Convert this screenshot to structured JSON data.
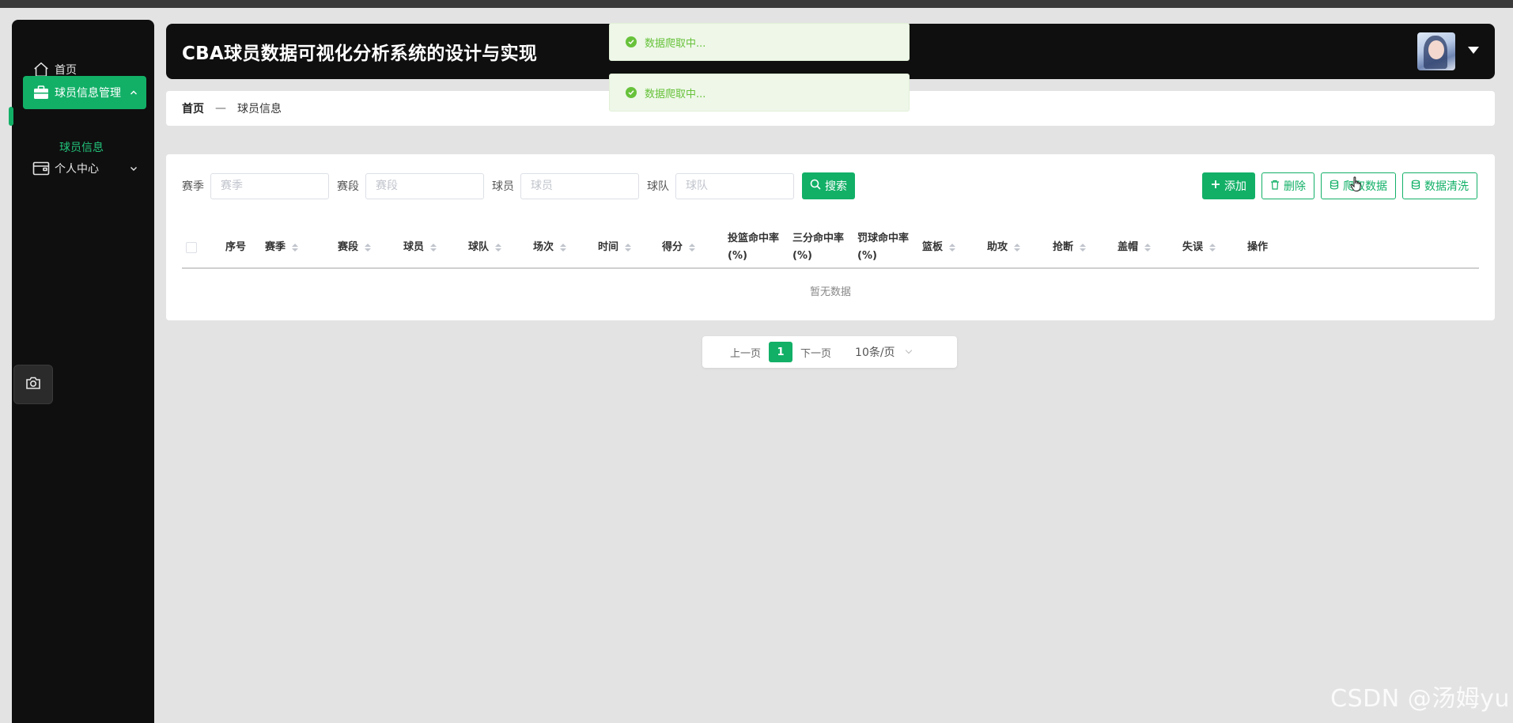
{
  "header": {
    "title": "CBA球员数据可视化分析系统的设计与实现"
  },
  "sidebar": {
    "items": [
      {
        "label": "首页",
        "icon": "home-icon"
      },
      {
        "label": "球员信息管理",
        "icon": "briefcase-icon",
        "expanded": true,
        "sub": [
          {
            "label": "球员信息"
          }
        ]
      },
      {
        "label": "个人中心",
        "icon": "wallet-icon",
        "expanded": false
      }
    ]
  },
  "breadcrumb": {
    "home": "首页",
    "sep": "—",
    "current": "球员信息"
  },
  "toasts": [
    {
      "text": "数据爬取中..."
    },
    {
      "text": "数据爬取中..."
    }
  ],
  "search": {
    "fields": [
      {
        "label": "赛季",
        "placeholder": "赛季"
      },
      {
        "label": "赛段",
        "placeholder": "赛段"
      },
      {
        "label": "球员",
        "placeholder": "球员"
      },
      {
        "label": "球队",
        "placeholder": "球队"
      }
    ],
    "button": "搜索"
  },
  "actions": {
    "add": "添加",
    "delete": "删除",
    "crawl": "爬取数据",
    "clean": "数据清洗"
  },
  "table": {
    "columns": [
      {
        "label": "序号",
        "sortable": false
      },
      {
        "label": "赛季",
        "sortable": true
      },
      {
        "label": "赛段",
        "sortable": true
      },
      {
        "label": "球员",
        "sortable": true
      },
      {
        "label": "球队",
        "sortable": true
      },
      {
        "label": "场次",
        "sortable": true
      },
      {
        "label": "时间",
        "sortable": true
      },
      {
        "label": "得分",
        "sortable": true
      },
      {
        "label": "投篮命中率",
        "label2": "(%)",
        "sortable": false
      },
      {
        "label": "三分命中率",
        "label2": "(%)",
        "sortable": false
      },
      {
        "label": "罚球命中率",
        "label2": "(%)",
        "sortable": false
      },
      {
        "label": "篮板",
        "sortable": true
      },
      {
        "label": "助攻",
        "sortable": true
      },
      {
        "label": "抢断",
        "sortable": true
      },
      {
        "label": "盖帽",
        "sortable": true
      },
      {
        "label": "失误",
        "sortable": true
      },
      {
        "label": "操作",
        "sortable": false
      }
    ],
    "empty_text": "暂无数据"
  },
  "pagination": {
    "prev": "上一页",
    "current": "1",
    "next": "下一页",
    "page_size": "10条/页"
  },
  "watermark": "CSDN @汤姆yu",
  "colors": {
    "accent": "#12b067",
    "toast_text": "#67c23a",
    "sidebar_bg": "#0f0f0f"
  }
}
